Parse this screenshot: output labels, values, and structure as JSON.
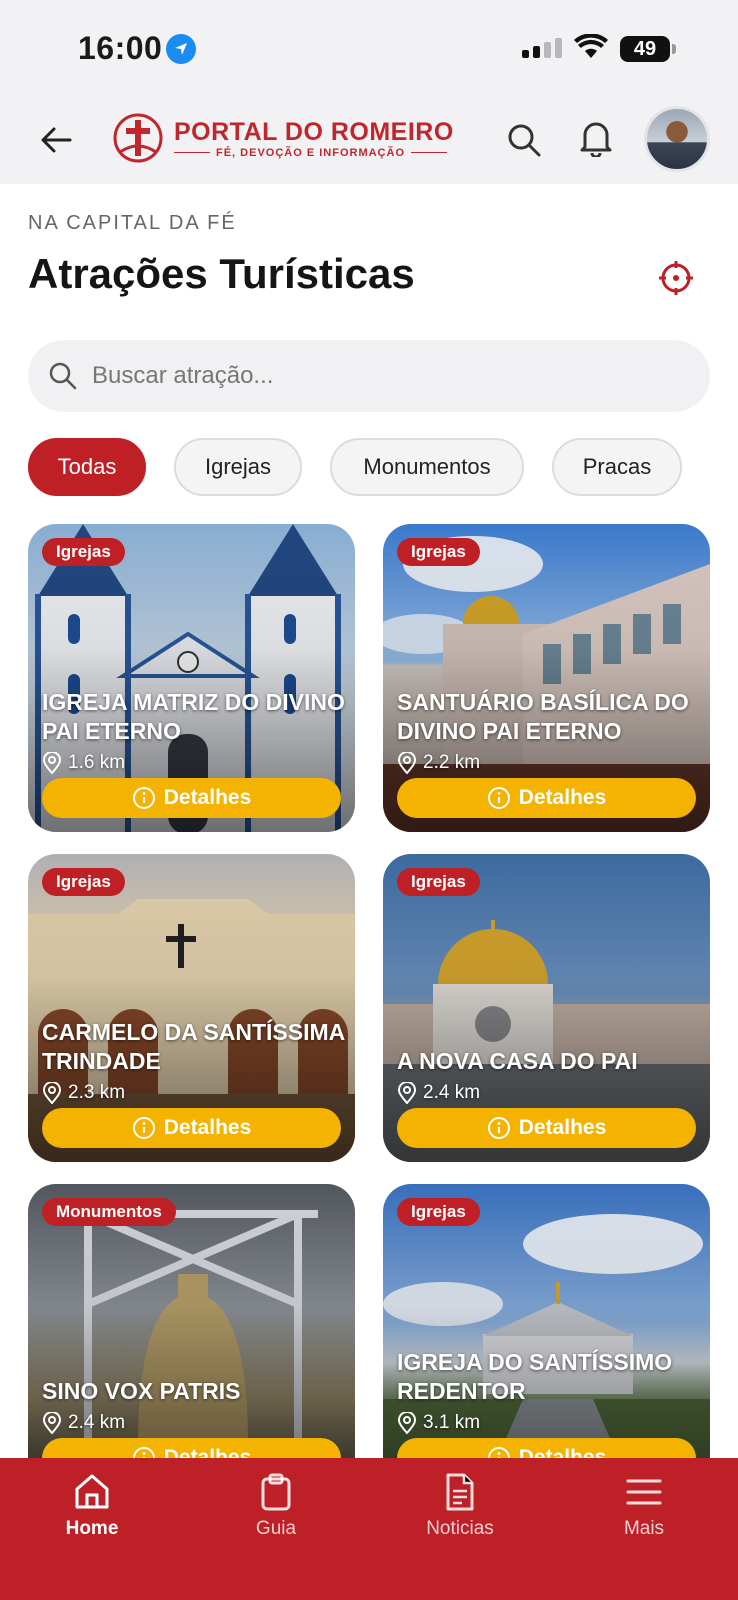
{
  "status_bar": {
    "time": "16:00",
    "battery": "49"
  },
  "header": {
    "logo_title": "PORTAL DO ROMEIRO",
    "logo_subtitle": "FÉ, DEVOÇÃO E INFORMAÇÃO"
  },
  "page": {
    "eyebrow": "NA CAPITAL DA FÉ",
    "title": "Atrações Turísticas"
  },
  "search": {
    "placeholder": "Buscar atração..."
  },
  "filters": [
    {
      "label": "Todas",
      "active": true
    },
    {
      "label": "Igrejas",
      "active": false
    },
    {
      "label": "Monumentos",
      "active": false
    },
    {
      "label": "Pracas",
      "active": false
    }
  ],
  "attractions": [
    {
      "category": "Igrejas",
      "name": "Igreja Matriz do Divino Pai Eterno",
      "distance": "1.6 km",
      "button": "Detalhes"
    },
    {
      "category": "Igrejas",
      "name": "Santuário Basílica do Divino Pai Eterno",
      "distance": "2.2 km",
      "button": "Detalhes"
    },
    {
      "category": "Igrejas",
      "name": "Carmelo da Santíssima Trindade",
      "distance": "2.3 km",
      "button": "Detalhes"
    },
    {
      "category": "Igrejas",
      "name": "A Nova Casa do Pai",
      "distance": "2.4 km",
      "button": "Detalhes"
    },
    {
      "category": "Monumentos",
      "name": "Sino Vox Patris",
      "distance": "2.4 km",
      "button": "Detalhes"
    },
    {
      "category": "Igrejas",
      "name": "Igreja do Santíssimo Redentor",
      "distance": "3.1 km",
      "button": "Detalhes"
    }
  ],
  "tabbar": [
    {
      "label": "Home",
      "icon": "home-icon",
      "active": true
    },
    {
      "label": "Guia",
      "icon": "clipboard-icon",
      "active": false
    },
    {
      "label": "Noticias",
      "icon": "document-icon",
      "active": false
    },
    {
      "label": "Mais",
      "icon": "menu-icon",
      "active": false
    }
  ],
  "colors": {
    "brand_red": "#bf2026",
    "button_yellow": "#f3b300",
    "header_bg": "#f2f2f4"
  }
}
